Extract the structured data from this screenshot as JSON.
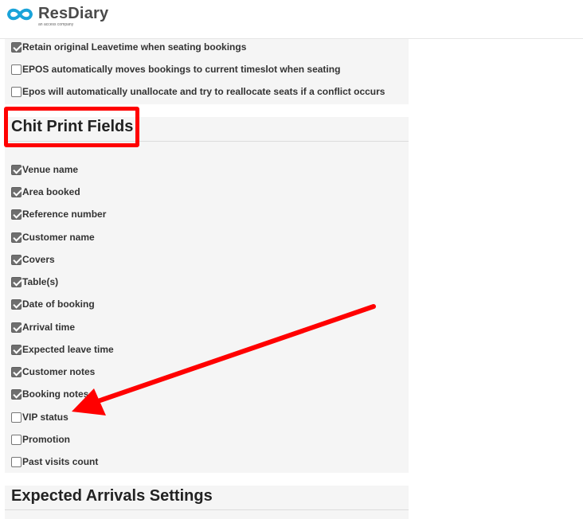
{
  "header": {
    "brand_name": "ResDiary",
    "brand_tagline": "an access company",
    "brand_color": "#1aa3d9"
  },
  "top_settings": [
    {
      "label": "Retain original Leavetime when seating bookings",
      "checked": true
    },
    {
      "label": "EPOS automatically moves bookings to current timeslot when seating",
      "checked": false
    },
    {
      "label": "Epos will automatically unallocate and try to reallocate seats if a conflict occurs",
      "checked": false
    }
  ],
  "chit_section": {
    "title": "Chit Print Fields",
    "fields": [
      {
        "label": "Venue name",
        "checked": true
      },
      {
        "label": "Area booked",
        "checked": true
      },
      {
        "label": "Reference number",
        "checked": true
      },
      {
        "label": "Customer name",
        "checked": true
      },
      {
        "label": "Covers",
        "checked": true
      },
      {
        "label": "Table(s)",
        "checked": true
      },
      {
        "label": "Date of booking",
        "checked": true
      },
      {
        "label": "Arrival time",
        "checked": true
      },
      {
        "label": "Expected leave time",
        "checked": true
      },
      {
        "label": "Customer notes",
        "checked": true
      },
      {
        "label": "Booking notes",
        "checked": true
      },
      {
        "label": "VIP status",
        "checked": false
      },
      {
        "label": "Promotion",
        "checked": false
      },
      {
        "label": "Past visits count",
        "checked": false
      }
    ]
  },
  "arrivals_section": {
    "title": "Expected Arrivals Settings"
  },
  "annotation": {
    "highlight_color": "#ff0000",
    "arrow_color": "#ff0000"
  }
}
